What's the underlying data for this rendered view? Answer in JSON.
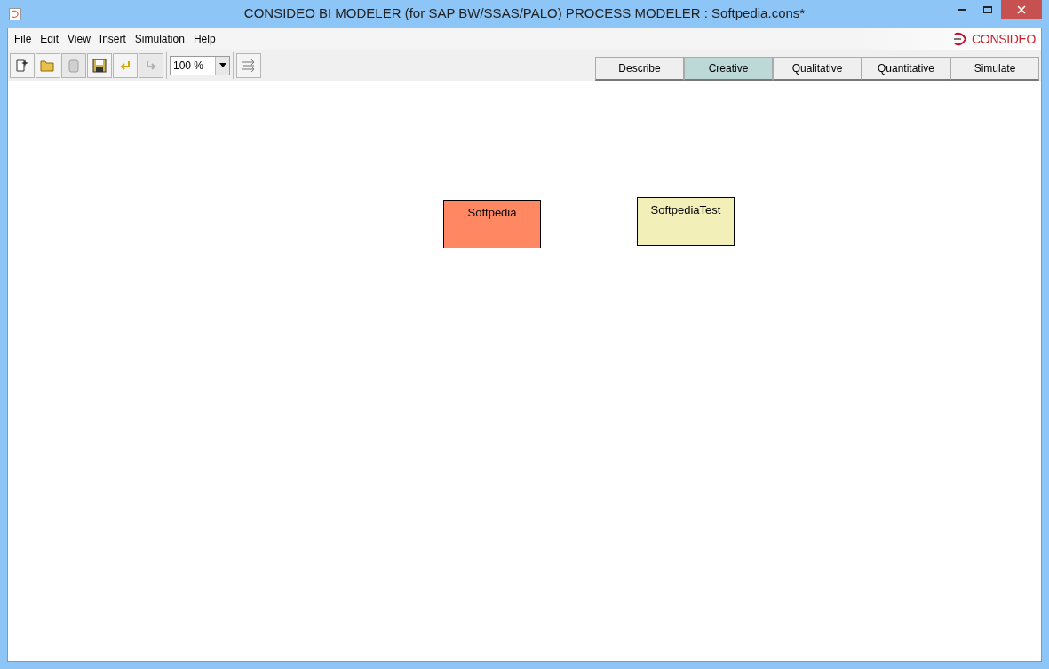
{
  "window": {
    "title": "CONSIDEO BI MODELER (for SAP BW/SSAS/PALO) PROCESS MODELER : Softpedia.cons*"
  },
  "menu": [
    "File",
    "Edit",
    "View",
    "Insert",
    "Simulation",
    "Help"
  ],
  "logo": {
    "text": "CONSIDEO"
  },
  "toolbar": [
    {
      "kind": "new",
      "disabled": false
    },
    {
      "kind": "open",
      "disabled": false
    },
    {
      "kind": "delete",
      "disabled": true
    },
    {
      "kind": "save",
      "disabled": false
    },
    {
      "kind": "undo",
      "disabled": false
    },
    {
      "kind": "redo",
      "disabled": true
    }
  ],
  "zoom": {
    "value": "100 %"
  },
  "modes": [
    {
      "label": "Describe",
      "selected": false
    },
    {
      "label": "Creative",
      "selected": true
    },
    {
      "label": "Qualitative",
      "selected": false
    },
    {
      "label": "Quantitative",
      "selected": false
    },
    {
      "label": "Simulate",
      "selected": false
    }
  ],
  "nodes": [
    {
      "label": "Softpedia",
      "color": "#ff8862"
    },
    {
      "label": "SoftpediaTest",
      "color": "#f2f0b8"
    }
  ]
}
